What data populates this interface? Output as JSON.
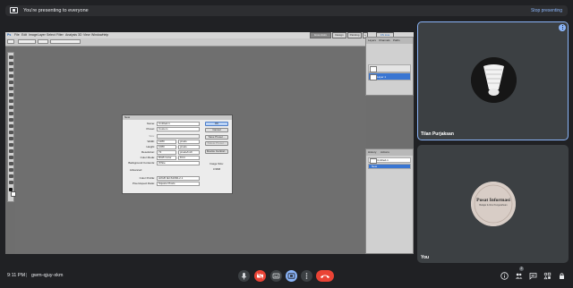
{
  "topbar": {
    "presenting_text": "You're presenting to everyone",
    "stop_label": "Stop presenting"
  },
  "photoshop": {
    "menus": [
      "Ps",
      "File",
      "Edit",
      "Image",
      "Layer",
      "Select",
      "Filter",
      "Analysis",
      "3D",
      "View",
      "Window",
      "Help"
    ],
    "right_buttons": [
      "Essentials",
      "Design",
      "Painting",
      "»",
      "CS Live"
    ],
    "layers_panel": {
      "tabs": [
        "Layers",
        "Channels",
        "Paths"
      ],
      "rows": [
        "Layer 1"
      ]
    },
    "history_panel": {
      "tabs": [
        "History",
        "Actions"
      ],
      "rows": [
        "Untitled-1",
        "New"
      ]
    },
    "new_dialog": {
      "title": "New",
      "fields": [
        {
          "label": "Name:",
          "value": "Untitled-1"
        },
        {
          "label": "Preset:",
          "value": "Custom"
        },
        {
          "label": "Size:",
          "value": ""
        },
        {
          "label": "Width:",
          "value": "1280",
          "unit": "pixels"
        },
        {
          "label": "Height:",
          "value": "1080",
          "unit": "pixels"
        },
        {
          "label": "Resolution:",
          "value": "72",
          "unit": "pixels/inch"
        },
        {
          "label": "Color Mode:",
          "value": "RGB Color",
          "unit": "8 bit"
        },
        {
          "label": "Background Contents:",
          "value": "White"
        },
        {
          "label": "Advanced",
          "value": ""
        },
        {
          "label": "Color Profile:",
          "value": "sRGB IEC61966-2.1"
        },
        {
          "label": "Pixel Aspect Ratio:",
          "value": "Square Pixels"
        }
      ],
      "buttons": [
        "OK",
        "Cancel",
        "Save Preset...",
        "Delete Preset...",
        "Device Central..."
      ],
      "image_size_label": "Image Size:",
      "image_size_value": "3.96M"
    }
  },
  "participants": [
    {
      "name": "Tilan Purjaksan"
    },
    {
      "name": "You"
    }
  ],
  "avatar_text": {
    "line1": "Pusat Informasi",
    "line2": "Belajar & Ilmu Pengetahuan"
  },
  "bottombar": {
    "time": "9:11 PM",
    "separator": "|",
    "meeting_code": "gwm-qjuy-xkm",
    "people_count": "2"
  },
  "colors": {
    "end_call": "#ea4335",
    "camera_off": "#ea4335",
    "present_active": "#8ab4f8",
    "tile_border": "#8ab4f8"
  },
  "icons": [
    "present-icon",
    "mic-icon",
    "camera-off-icon",
    "captions-icon",
    "present-screen-icon",
    "more-icon",
    "end-call-icon",
    "info-icon",
    "people-icon",
    "chat-icon",
    "activities-icon",
    "lock-icon"
  ]
}
